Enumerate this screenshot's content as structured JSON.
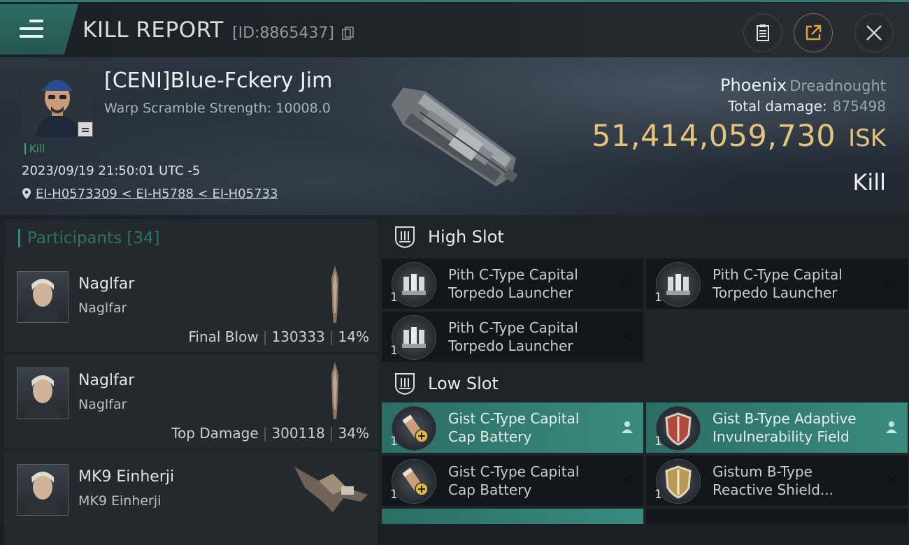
{
  "header": {
    "title": "KILL REPORT",
    "report_id": "[ID:8865437]",
    "menu_icon": "hamburger-icon",
    "buttons": [
      "clipboard-icon",
      "share-icon",
      "close-icon"
    ]
  },
  "victim": {
    "name": "[CENI]Blue-Fckery Jim",
    "warp_scramble": "Warp Scramble Strength: 10008.0",
    "kill_tag": "Kill",
    "datetime": "2023/09/19 21:50:01 UTC -5",
    "location": "EI-H0573309 < EI-H5788 < EI-H05733",
    "ship_name": "Phoenix",
    "ship_class": "Dreadnought",
    "total_damage_label": "Total damage:",
    "total_damage": "875498",
    "isk_value": "51,414,059,730",
    "isk_unit": "ISK",
    "result": "Kill"
  },
  "participants": {
    "label": "Participants [34]",
    "rows": [
      {
        "name": "Naglfar",
        "ship": "Naglfar",
        "role": "Final Blow",
        "damage": "130333",
        "percent": "14%"
      },
      {
        "name": "Naglfar",
        "ship": "Naglfar",
        "role": "Top Damage",
        "damage": "300118",
        "percent": "34%"
      },
      {
        "name": "MK9 Einherji",
        "ship": "MK9 Einherji",
        "role": "",
        "damage": "",
        "percent": ""
      }
    ]
  },
  "fitting": {
    "high_slot_label": "High Slot",
    "low_slot_label": "Low Slot",
    "high": [
      {
        "line1": "Pith C-Type Capital",
        "line2": "Torpedo Launcher",
        "qty": "1",
        "status": "destroyed"
      },
      {
        "line1": "Pith C-Type Capital",
        "line2": "Torpedo Launcher",
        "qty": "1",
        "status": "destroyed"
      },
      {
        "line1": "Pith C-Type Capital",
        "line2": "Torpedo Launcher",
        "qty": "1",
        "status": "destroyed"
      }
    ],
    "low": [
      {
        "line1": "Gist C-Type Capital",
        "line2": "Cap Battery",
        "qty": "1",
        "status": "dropped"
      },
      {
        "line1": "Gist B-Type Adaptive",
        "line2": "Invulnerability Field",
        "qty": "1",
        "status": "dropped"
      },
      {
        "line1": "Gist C-Type Capital",
        "line2": "Cap Battery",
        "qty": "1",
        "status": "destroyed"
      },
      {
        "line1": "Gistum B-Type",
        "line2": "Reactive Shield...",
        "qty": "1",
        "status": "destroyed"
      }
    ]
  },
  "colors": {
    "accent": "#2c7b6f",
    "isk": "#e7c27a",
    "kill": "#3fa070"
  }
}
